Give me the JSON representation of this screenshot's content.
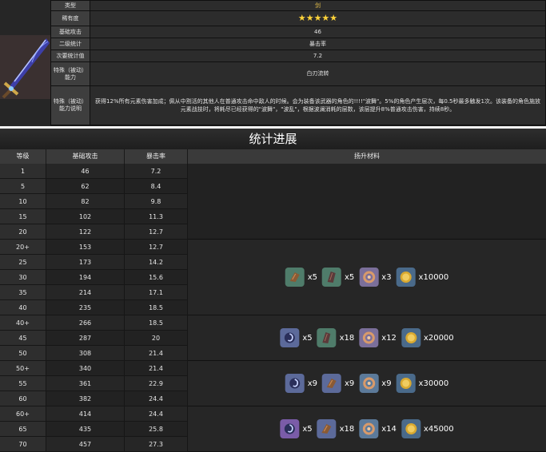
{
  "info": {
    "rows": [
      {
        "key": "类型",
        "value": "剑"
      },
      {
        "key": "稀有度",
        "value": "★★★★★"
      },
      {
        "key": "基础攻击",
        "value": "46"
      },
      {
        "key": "二级统计",
        "value": "暴击率"
      },
      {
        "key": "次要统计值",
        "value": "7.2"
      },
      {
        "key": "特殊（被动）能力",
        "value": "白刃流转"
      },
      {
        "key": "特殊（被动）能力说明",
        "value": "获得12%所有元素伤害加成；佩从中割活的其他人在普通攻击命中敌人的时候。会为装备该武器的角色的!!!!\"波舞\"。5%的角色产生层次，每0.5秒最多触发1次。该装备的角色施放元素战技时，将耗尽已经获得的\"波舞\"，\"波乱\"，根据波澜消耗的层数，该层提升8%普通攻击伤害，持续8秒。"
      }
    ]
  },
  "progression": {
    "title": "统计进展",
    "headers": {
      "level": "等级",
      "atk": "基础攻击",
      "crit": "暴击率",
      "materials": "扬升材料"
    },
    "rows": [
      {
        "level": "1",
        "atk": "46",
        "crit": "7.2"
      },
      {
        "level": "5",
        "atk": "62",
        "crit": "8.4"
      },
      {
        "level": "10",
        "atk": "82",
        "crit": "9.8"
      },
      {
        "level": "15",
        "atk": "102",
        "crit": "11.3"
      },
      {
        "level": "20",
        "atk": "122",
        "crit": "12.7"
      },
      {
        "level": "20+",
        "atk": "153",
        "crit": "12.7"
      },
      {
        "level": "25",
        "atk": "173",
        "crit": "14.2"
      },
      {
        "level": "30",
        "atk": "194",
        "crit": "15.6"
      },
      {
        "level": "35",
        "atk": "214",
        "crit": "17.1"
      },
      {
        "level": "40",
        "atk": "235",
        "crit": "18.5"
      },
      {
        "level": "40+",
        "atk": "266",
        "crit": "18.5"
      },
      {
        "level": "45",
        "atk": "287",
        "crit": "20"
      },
      {
        "level": "50",
        "atk": "308",
        "crit": "21.4"
      },
      {
        "level": "50+",
        "atk": "340",
        "crit": "21.4"
      },
      {
        "level": "55",
        "atk": "361",
        "crit": "22.9"
      },
      {
        "level": "60",
        "atk": "382",
        "crit": "24.4"
      },
      {
        "level": "60+",
        "atk": "414",
        "crit": "24.4"
      },
      {
        "level": "65",
        "atk": "435",
        "crit": "25.8"
      },
      {
        "level": "70",
        "atk": "457",
        "crit": "27.3"
      }
    ],
    "material_groups": [
      {
        "rows": 5,
        "items": []
      },
      {
        "rows": 5,
        "items": [
          {
            "icon": "claw-shard-icon",
            "count": "x5",
            "color": "#4f7c6a"
          },
          {
            "icon": "dark-shard-icon",
            "count": "x5",
            "color": "#4f7c6a"
          },
          {
            "icon": "rune-ring-icon",
            "count": "x3",
            "color": "#7b6f9a"
          },
          {
            "icon": "mora-coin-icon",
            "count": "x10000",
            "color": "#4a6a8a"
          }
        ]
      },
      {
        "rows": 3,
        "items": [
          {
            "icon": "swirl-gem-icon",
            "count": "x5",
            "color": "#5c6a9a"
          },
          {
            "icon": "dark-shard-icon",
            "count": "x18",
            "color": "#4f7c6a"
          },
          {
            "icon": "rune-ring-icon",
            "count": "x12",
            "color": "#7b6f9a"
          },
          {
            "icon": "mora-coin-icon",
            "count": "x20000",
            "color": "#4a6a8a"
          }
        ]
      },
      {
        "rows": 3,
        "items": [
          {
            "icon": "swirl-gem-icon",
            "count": "x9",
            "color": "#5c6a9a"
          },
          {
            "icon": "claw-shard-icon",
            "count": "x9",
            "color": "#5c6a9a"
          },
          {
            "icon": "rune-ring-icon",
            "count": "x9",
            "color": "#5c7a9a"
          },
          {
            "icon": "mora-coin-icon",
            "count": "x30000",
            "color": "#4a6a8a"
          }
        ]
      },
      {
        "rows": 3,
        "items": [
          {
            "icon": "swirl-gem-icon",
            "count": "x5",
            "color": "#7a5ca8"
          },
          {
            "icon": "claw-shard-icon",
            "count": "x18",
            "color": "#5c6a9a"
          },
          {
            "icon": "rune-ring-icon",
            "count": "x14",
            "color": "#5c7a9a"
          },
          {
            "icon": "mora-coin-icon",
            "count": "x45000",
            "color": "#4a6a8a"
          }
        ]
      }
    ]
  }
}
